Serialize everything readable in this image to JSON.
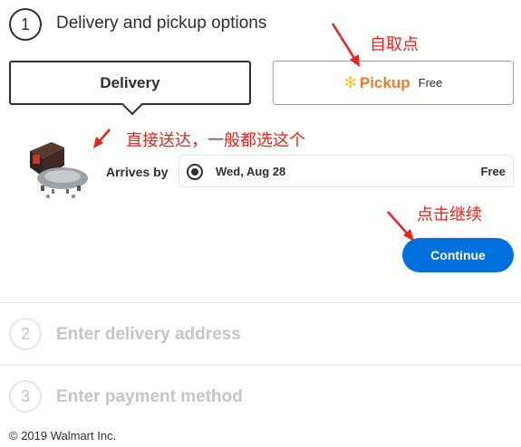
{
  "steps": [
    {
      "number": "1",
      "title": "Delivery and pickup options"
    },
    {
      "number": "2",
      "title": "Enter delivery address"
    },
    {
      "number": "3",
      "title": "Enter payment method"
    }
  ],
  "options": {
    "delivery": {
      "label": "Delivery"
    },
    "pickup": {
      "label": "Pickup",
      "price": "Free"
    }
  },
  "arrival": {
    "label": "Arrives by",
    "date": "Wed, Aug 28",
    "price": "Free"
  },
  "continue_label": "Continue",
  "footer": "© 2019 Walmart Inc.",
  "annotations": {
    "pickup": "自取点",
    "delivery": "直接送达，一般都选这个",
    "continue": "点击继续"
  },
  "colors": {
    "accent_blue": "#0071dc",
    "pickup_orange": "#f47a23",
    "spark_yellow": "#ffc220",
    "annotation_red": "#e8241c"
  },
  "icons": {
    "pickup": "walmart-spark-icon",
    "product": "product-thumbnail"
  }
}
